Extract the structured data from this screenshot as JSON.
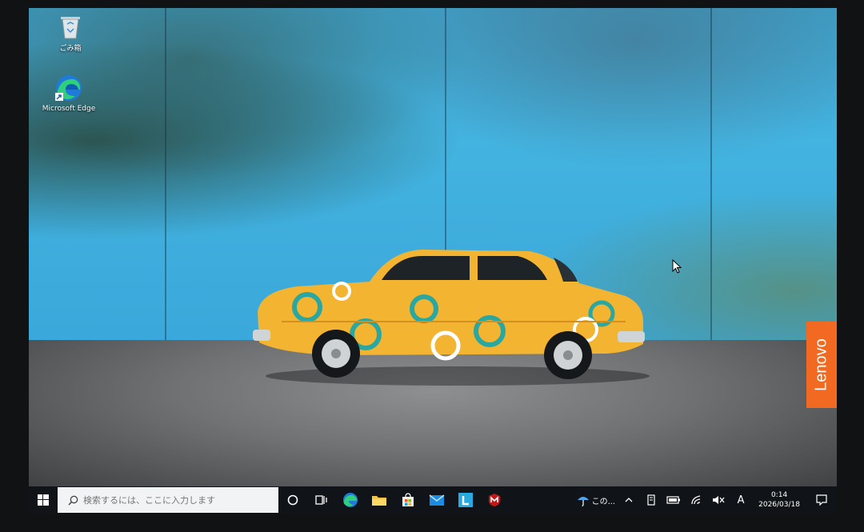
{
  "desktop": {
    "icons": [
      {
        "label": "ごみ箱",
        "icon": "recycle-bin-icon"
      },
      {
        "label": "Microsoft Edge",
        "icon": "edge-icon"
      }
    ],
    "watermark": "Lenovo"
  },
  "taskbar": {
    "search_placeholder": "検索するには、ここに入力します",
    "pinned": [
      "start-icon",
      "cortana-icon",
      "task-view-icon",
      "edge-icon",
      "file-explorer-icon",
      "store-icon",
      "mail-icon",
      "lenovo-l-icon",
      "mcafee-icon"
    ],
    "tray": {
      "weather_text": "この...",
      "ime_mode": "A",
      "time": "0:14",
      "date": "2026/03/18"
    }
  },
  "colors": {
    "taskbar": "#101418",
    "lenovo": "#f26a21",
    "car": "#f2b431",
    "car_rings": "#2aa7a0"
  }
}
